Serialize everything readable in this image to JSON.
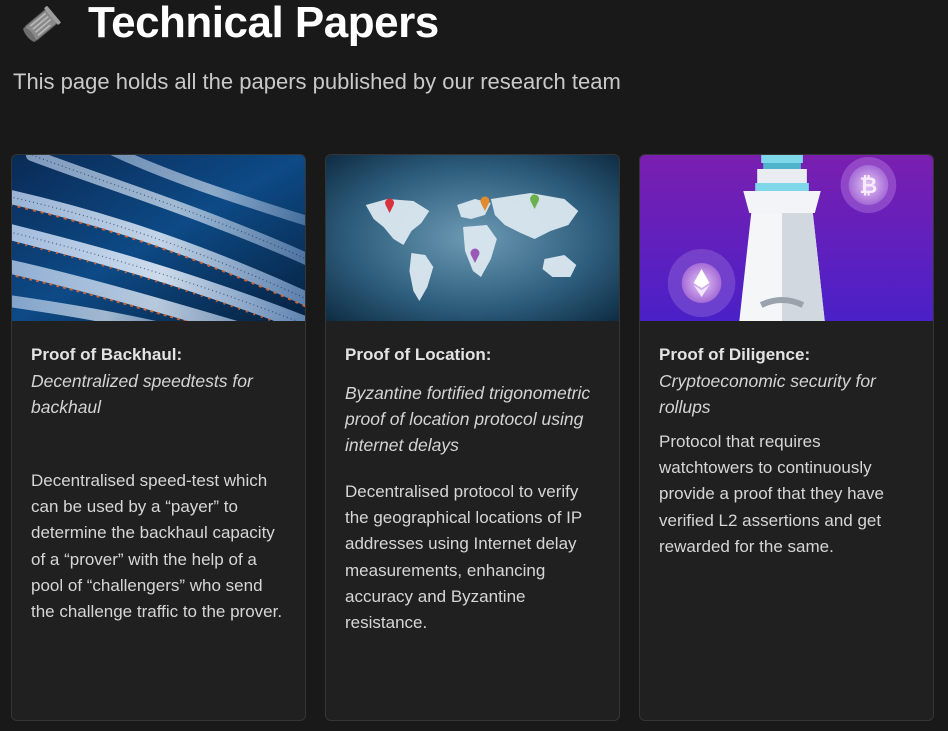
{
  "page": {
    "icon": "newspaper-roll-icon",
    "title": "Technical Papers",
    "subtitle": "This page holds all the papers published by our research team"
  },
  "papers": [
    {
      "image": "fiber-optic-cables-image",
      "title": "Proof of Backhaul:",
      "subtitle": "Decentralized speedtests for backhaul",
      "description": "Decentralised speed-test which can be used by a “payer” to determine the backhaul capacity of a “prover” with the help of a pool of “challengers” who send the challenge traffic to the prover."
    },
    {
      "image": "world-map-pins-image",
      "title": "Proof of Location:",
      "subtitle": "Byzantine fortified trigonometric proof of location protocol using internet delays",
      "description": "Decentralised protocol to verify the geographical locations of IP addresses using Internet delay measurements, enhancing accuracy and Byzantine resistance."
    },
    {
      "image": "watchtower-crypto-coins-image",
      "title": "Proof of Diligence:",
      "subtitle": "Cryptoeconomic security for rollups",
      "description": "Protocol that requires watchtowers to continuously provide a proof that they have verified L2 assertions and get rewarded for the same."
    }
  ],
  "colors": {
    "background": "#191919",
    "card": "#202020",
    "card_border": "#353535",
    "title": "#ffffff"
  }
}
